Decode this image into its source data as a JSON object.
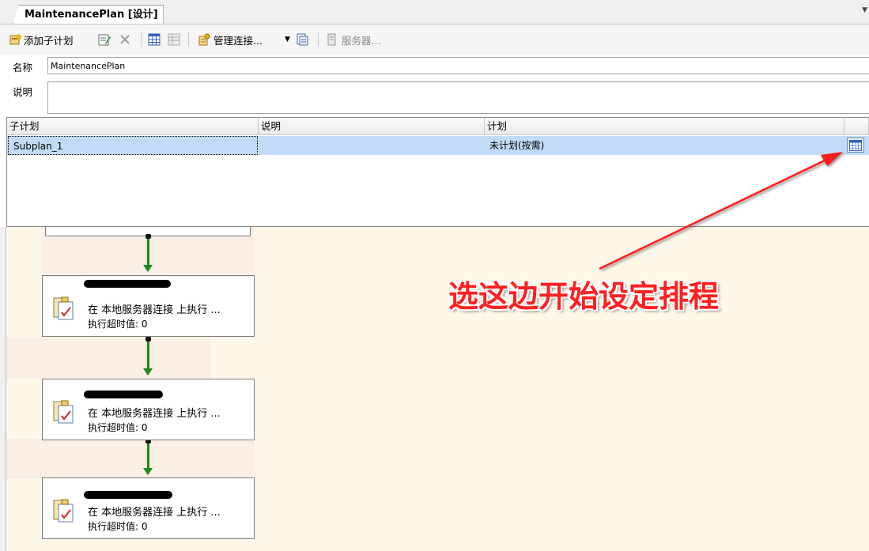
{
  "tab": {
    "title": "MaintenancePlan [设计]"
  },
  "toolbar": {
    "add_subplan_label": "添加子计划",
    "manage_connections_label": "管理连接...",
    "servers_label": "服务器..."
  },
  "properties": {
    "name_label": "名称",
    "name_value": "MaintenancePlan",
    "desc_label": "说明",
    "desc_value": ""
  },
  "grid": {
    "headers": [
      "子计划",
      "说明",
      "计划"
    ],
    "rows": [
      {
        "subplan": "Subplan_1",
        "description": "",
        "schedule": "未计划(按需)"
      }
    ]
  },
  "tasks": [
    {
      "line1": "在 本地服务器连接 上执行 ...",
      "line2": "执行超时值: 0"
    },
    {
      "line1": "在 本地服务器连接 上执行 ...",
      "line2": "执行超时值: 0"
    },
    {
      "line1": "在 本地服务器连接 上执行 ...",
      "line2": "执行超时值: 0"
    }
  ],
  "annotation": {
    "text": "选这边开始设定排程",
    "color": "#ff2020"
  },
  "colors": {
    "selection": "#c2dcf7",
    "designer_bg": "#fdf8e8",
    "connector": "#1a8a1a"
  },
  "icons": [
    "add-subplan-icon",
    "subplan-properties-icon",
    "delete-icon",
    "grid-icon",
    "grid-disabled-icon",
    "manage-connections-icon",
    "dropdown-arrow-icon",
    "report-icon",
    "servers-icon",
    "schedule-calendar-icon",
    "task-icon"
  ]
}
